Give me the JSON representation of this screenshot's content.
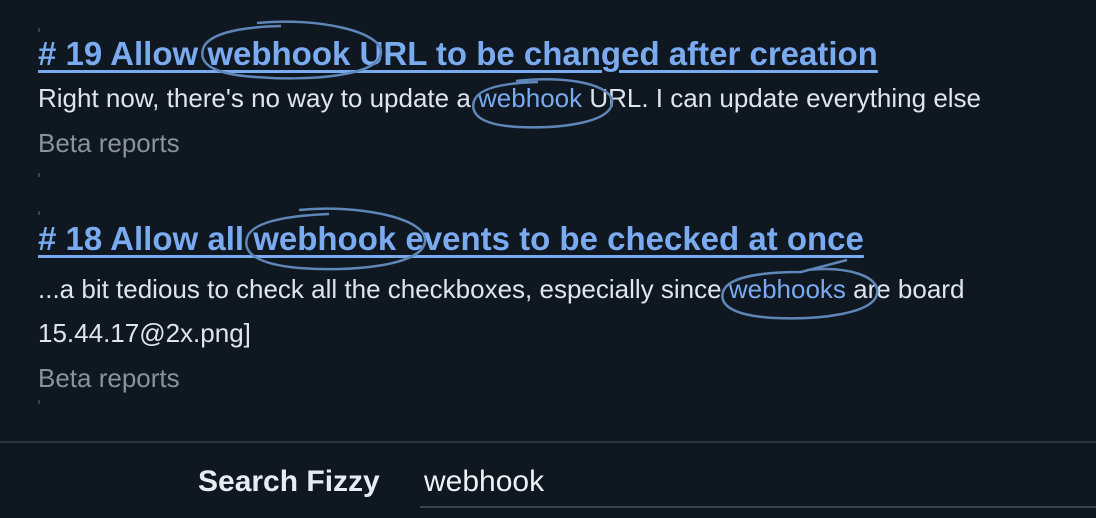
{
  "results": [
    {
      "title_prefix": "# 19 Allow ",
      "title_match": "webhook",
      "title_suffix": " URL to be changed after creation",
      "snippet_before": "Right now, there's no way to update a ",
      "snippet_match": "webhook",
      "snippet_after": " URL. I can update everything else",
      "collection": "Beta reports"
    },
    {
      "title_prefix": "# 18 Allow all ",
      "title_match": "webhook",
      "title_suffix": " events to be checked at once",
      "snippet_before": "...a bit tedious to check all the checkboxes, especially since ",
      "snippet_match": "webhooks",
      "snippet_after": " are board",
      "snippet_line2": "15.44.17@2x.png]",
      "collection": "Beta reports"
    }
  ],
  "search": {
    "label": "Search Fizzy",
    "value": "webhook"
  },
  "colors": {
    "background": "#0f1720",
    "link": "#7aaaf0",
    "highlight_circle": "#5e86b8",
    "text": "#dfe5ec",
    "muted": "#8a939d"
  }
}
